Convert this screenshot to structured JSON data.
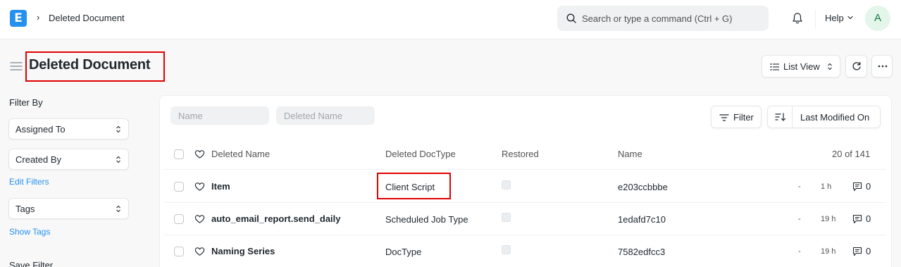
{
  "navbar": {
    "logo_letter": "E",
    "breadcrumb": "Deleted Document",
    "search_placeholder": "Search or type a command (Ctrl + G)",
    "help_label": "Help",
    "avatar_initial": "A"
  },
  "page": {
    "title": "Deleted Document",
    "list_view_label": "List View"
  },
  "sidebar": {
    "filter_by": "Filter By",
    "assigned_to": "Assigned To",
    "created_by": "Created By",
    "edit_filters": "Edit Filters",
    "tags": "Tags",
    "show_tags": "Show Tags",
    "save_filter": "Save Filter"
  },
  "filters": {
    "name_placeholder": "Name",
    "deleted_name_placeholder": "Deleted Name",
    "filter_label": "Filter",
    "sort_label": "Last Modified On"
  },
  "table": {
    "columns": {
      "deleted_name": "Deleted Name",
      "deleted_doctype": "Deleted DocType",
      "restored": "Restored",
      "name": "Name",
      "count": "20 of 141"
    },
    "rows": [
      {
        "deleted_name": "Item",
        "deleted_doctype": "Client Script",
        "name": "e203ccbbbe",
        "dash": "-",
        "time": "1 h",
        "comments": "0"
      },
      {
        "deleted_name": "auto_email_report.send_daily",
        "deleted_doctype": "Scheduled Job Type",
        "name": "1edafd7c10",
        "dash": "-",
        "time": "19 h",
        "comments": "0"
      },
      {
        "deleted_name": "Naming Series",
        "deleted_doctype": "DocType",
        "name": "7582edfcc3",
        "dash": "-",
        "time": "19 h",
        "comments": "0"
      }
    ]
  },
  "colors": {
    "accent": "#2490ef",
    "highlight": "#e00000"
  }
}
